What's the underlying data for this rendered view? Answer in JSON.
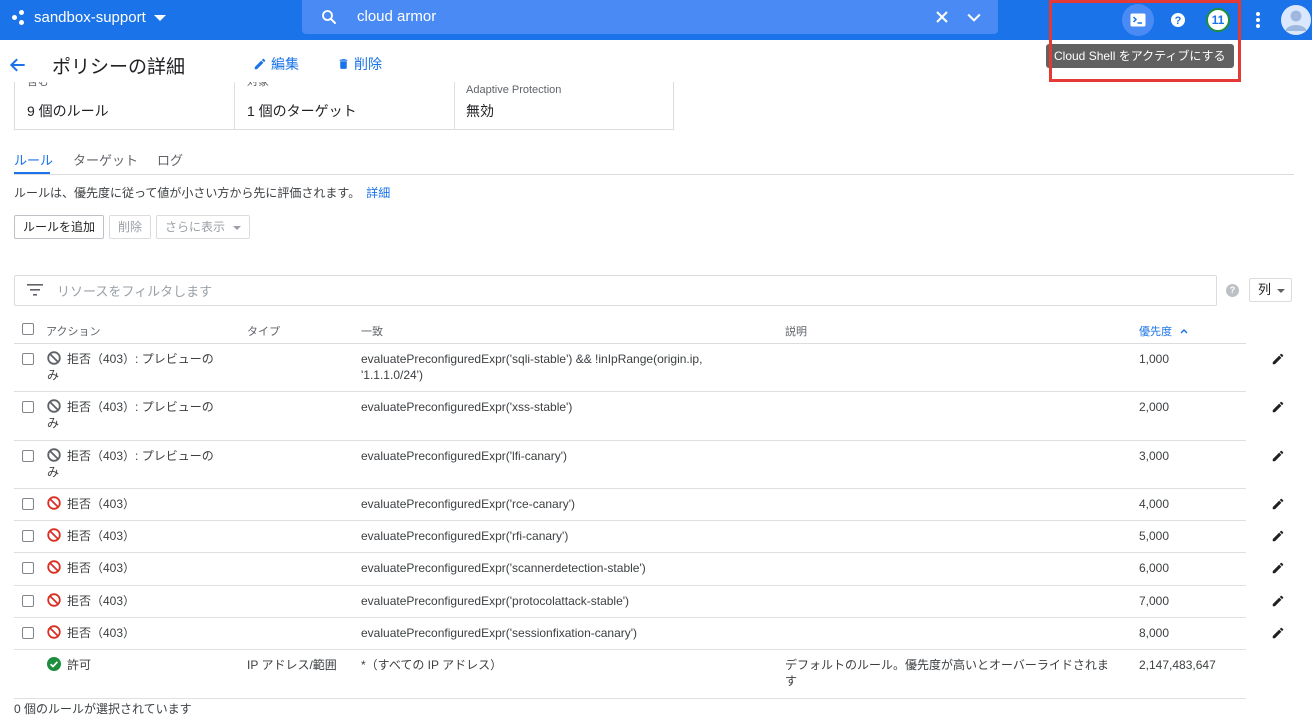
{
  "project": {
    "name": "sandbox-support"
  },
  "search": {
    "value": "cloud armor"
  },
  "topbar": {
    "notification_count": "11",
    "tooltip": "Cloud Shell をアクティブにする"
  },
  "header": {
    "title": "ポリシーの詳細",
    "edit_label": "編集",
    "delete_label": "削除"
  },
  "summary": [
    {
      "label": "含む",
      "value": "9 個のルール"
    },
    {
      "label": "対象",
      "value": "1 個のターゲット"
    },
    {
      "label": "Adaptive Protection",
      "value": "無効"
    }
  ],
  "tabs": [
    "ルール",
    "ターゲット",
    "ログ"
  ],
  "description": {
    "text": "ルールは、優先度に従って値が小さい方から先に評価されます。",
    "link": "詳細"
  },
  "toolbar": {
    "add_label": "ルールを追加",
    "delete_label": "削除",
    "more_label": "さらに表示"
  },
  "filter": {
    "placeholder": "リソースをフィルタします",
    "columns_label": "列"
  },
  "table": {
    "headers": {
      "action": "アクション",
      "type": "タイプ",
      "match": "一致",
      "description": "説明",
      "priority": "優先度"
    },
    "rows": [
      {
        "action": "拒否（403）: プレビューの",
        "action2": "み",
        "status": "preview",
        "type": "",
        "match": "evaluatePreconfiguredExpr('sqli-stable') && !inIpRange(origin.ip,",
        "match2": "'1.1.1.0/24')",
        "description": "",
        "description2": "",
        "priority": "1,000"
      },
      {
        "action": "拒否（403）: プレビューの",
        "action2": "み",
        "status": "preview",
        "type": "",
        "match": "evaluatePreconfiguredExpr('xss-stable')",
        "match2": "",
        "description": "",
        "description2": "",
        "priority": "2,000"
      },
      {
        "action": "拒否（403）: プレビューの",
        "action2": "み",
        "status": "preview",
        "type": "",
        "match": "evaluatePreconfiguredExpr('lfi-canary')",
        "match2": "",
        "description": "",
        "description2": "",
        "priority": "3,000"
      },
      {
        "action": "拒否（403）",
        "action2": "",
        "status": "deny",
        "type": "",
        "match": "evaluatePreconfiguredExpr('rce-canary')",
        "match2": "",
        "description": "",
        "description2": "",
        "priority": "4,000"
      },
      {
        "action": "拒否（403）",
        "action2": "",
        "status": "deny",
        "type": "",
        "match": "evaluatePreconfiguredExpr('rfi-canary')",
        "match2": "",
        "description": "",
        "description2": "",
        "priority": "5,000"
      },
      {
        "action": "拒否（403）",
        "action2": "",
        "status": "deny",
        "type": "",
        "match": "evaluatePreconfiguredExpr('scannerdetection-stable')",
        "match2": "",
        "description": "",
        "description2": "",
        "priority": "6,000"
      },
      {
        "action": "拒否（403）",
        "action2": "",
        "status": "deny",
        "type": "",
        "match": "evaluatePreconfiguredExpr('protocolattack-stable')",
        "match2": "",
        "description": "",
        "description2": "",
        "priority": "7,000"
      },
      {
        "action": "拒否（403）",
        "action2": "",
        "status": "deny",
        "type": "",
        "match": "evaluatePreconfiguredExpr('sessionfixation-canary')",
        "match2": "",
        "description": "",
        "description2": "",
        "priority": "8,000"
      },
      {
        "action": "許可",
        "action2": "",
        "status": "allow",
        "type": "IP アドレス/範囲",
        "match": "*（すべての IP アドレス）",
        "match2": "",
        "description": "デフォルトのルール。優先度が高いとオーバーライドされま",
        "description2": "す",
        "priority": "2,147,483,647"
      }
    ]
  },
  "footer": {
    "selected_text": "0 個のルールが選択されています"
  },
  "colors": {
    "brand": "#1a73e8",
    "deny": "#d93025",
    "allow": "#1e8e3e",
    "highlight": "#e53935"
  }
}
